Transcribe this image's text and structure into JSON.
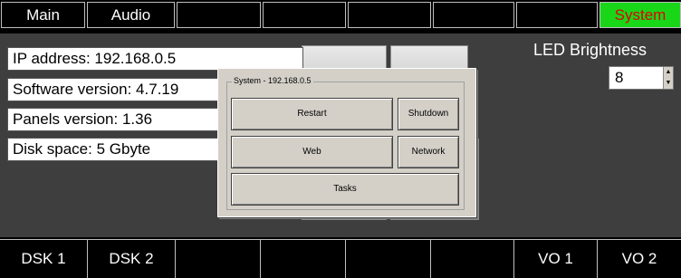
{
  "top_tabs": [
    {
      "label": "Main"
    },
    {
      "label": "Audio"
    },
    {
      "label": ""
    },
    {
      "label": ""
    },
    {
      "label": ""
    },
    {
      "label": ""
    },
    {
      "label": ""
    },
    {
      "label": "System"
    }
  ],
  "info": {
    "ip": "IP address: 192.168.0.5",
    "software": "Software version: 4.7.19",
    "panels": "Panels version: 1.36",
    "disk": "Disk space: 5 Gbyte"
  },
  "led": {
    "label": "LED Brightness",
    "value": "8"
  },
  "dialog": {
    "group_title": "System - 192.168.0.5",
    "restart": "Restart",
    "shutdown": "Shutdown",
    "web": "Web",
    "network": "Network",
    "tasks": "Tasks"
  },
  "bottom_tabs": [
    {
      "label": "DSK 1"
    },
    {
      "label": "DSK 2"
    },
    {
      "label": ""
    },
    {
      "label": ""
    },
    {
      "label": ""
    },
    {
      "label": ""
    },
    {
      "label": "VO 1"
    },
    {
      "label": "VO 2"
    }
  ],
  "colors": {
    "active_tab_bg": "#19d619",
    "active_tab_text": "#e00000",
    "panel_bg": "#3e3e3e"
  }
}
